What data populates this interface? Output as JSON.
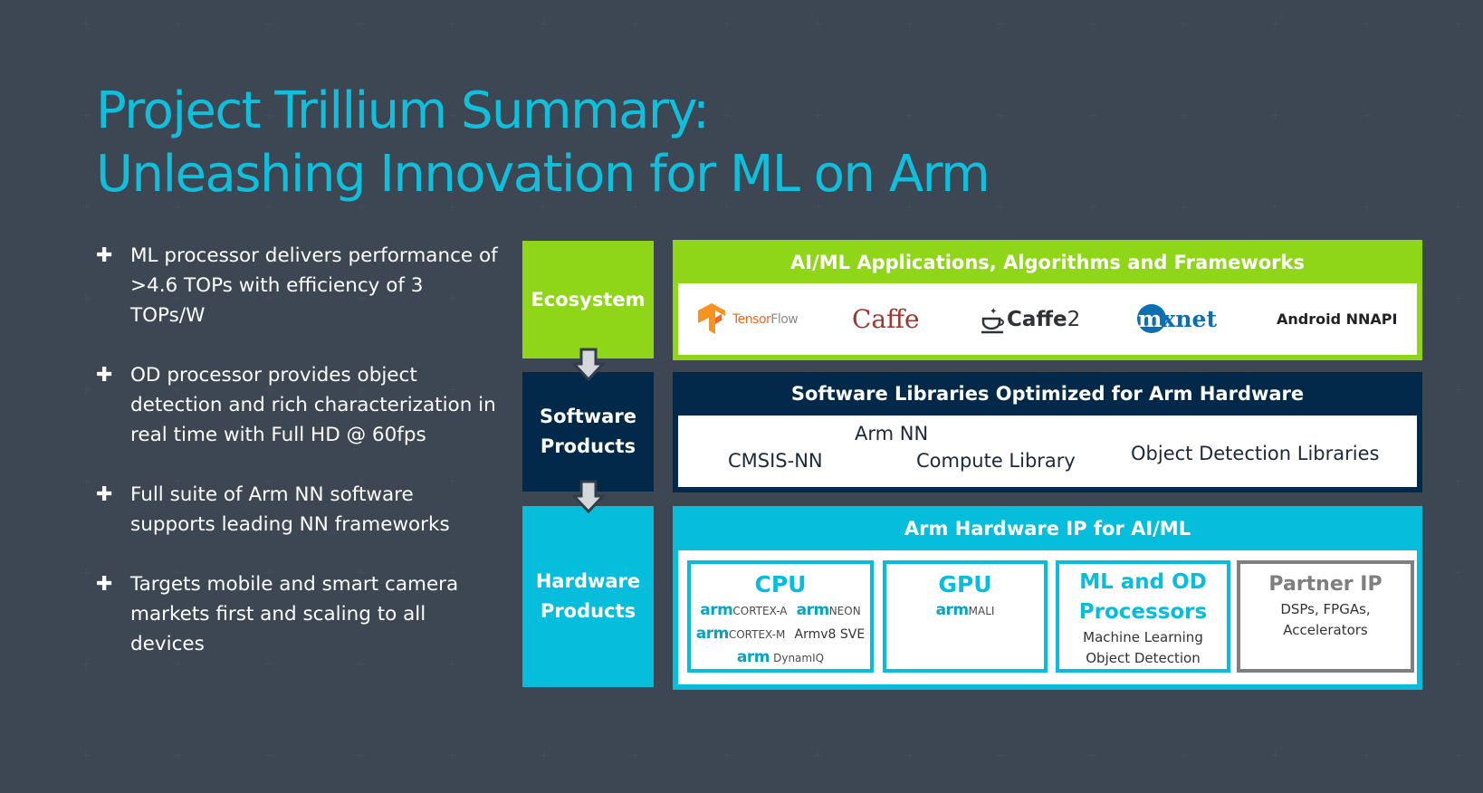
{
  "title": {
    "line1": "Project Trillium Summary:",
    "line2": "Unleashing Innovation for ML on Arm"
  },
  "bullets": [
    {
      "icon": "plus-icon",
      "text": "ML processor delivers performance of >4.6 TOPs with efficiency of 3 TOPs/W"
    },
    {
      "icon": "plus-icon",
      "text": "OD processor provides object detection and rich characterization in real time with Full HD @ 60fps"
    },
    {
      "icon": "plus-icon",
      "text": "Full suite of Arm NN software supports leading NN frameworks"
    },
    {
      "icon": "plus-icon",
      "text": "Targets mobile and smart camera markets first and scaling to all devices"
    }
  ],
  "layers": {
    "ecosystem": {
      "label": "Ecosystem",
      "color": "#8fd619",
      "header": "AI/ML Applications, Algorithms and Frameworks",
      "frameworks": {
        "tensorflow": {
          "a": "Tensor",
          "b": "Flow"
        },
        "caffe": "Caffe",
        "caffe2": {
          "a": "Caffe",
          "b": "2"
        },
        "mxnet": "mxnet",
        "nnapi": "Android NNAPI"
      }
    },
    "software": {
      "label_line1": "Software",
      "label_line2": "Products",
      "color": "#02294a",
      "header": "Software Libraries Optimized for Arm Hardware",
      "libraries": {
        "armnn": "Arm NN",
        "cmsis": "CMSIS-NN",
        "compute": "Compute Library",
        "objdet": "Object Detection Libraries"
      }
    },
    "hardware": {
      "label_line1": "Hardware",
      "label_line2": "Products",
      "color": "#06bedc",
      "header": "Arm Hardware IP for AI/ML",
      "cpu": {
        "title": "CPU",
        "items": [
          {
            "brand": "arm",
            "name": "CORTEX-A"
          },
          {
            "brand": "arm",
            "name": "NEON"
          },
          {
            "brand": "arm",
            "name": "CORTEX-M"
          },
          {
            "brand": "",
            "name": "Armv8 SVE"
          },
          {
            "brand": "arm",
            "name": "DynamIQ"
          }
        ]
      },
      "gpu": {
        "title": "GPU",
        "brand": "arm",
        "name": "MALI"
      },
      "mlod": {
        "title_line1": "ML and OD",
        "title_line2": "Processors",
        "sub1": "Machine Learning",
        "sub2": "Object Detection"
      },
      "partner": {
        "title": "Partner IP",
        "sub1": "DSPs, FPGAs,",
        "sub2": "Accelerators"
      }
    }
  }
}
